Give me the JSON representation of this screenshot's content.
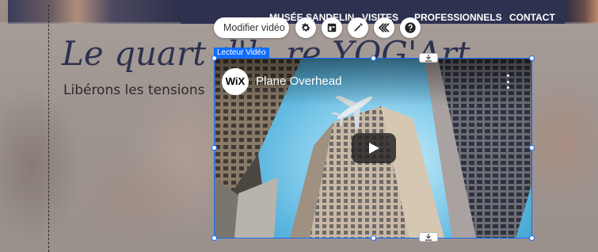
{
  "nav": {
    "items": [
      {
        "label": "MUSÉE SANDELIN"
      },
      {
        "label": "VISITES"
      },
      {
        "label": "PROFESSIONNELS"
      },
      {
        "label": "CONTACT"
      }
    ]
  },
  "hero": {
    "title": "Le quart d'h",
    "title_tail": "re YOG'Art",
    "subtitle": "Libérons les tensions"
  },
  "toolbar": {
    "edit_video_label": "Modifier vidéo",
    "icons": [
      "gear-icon",
      "layout-icon",
      "pen-icon",
      "animation-icon",
      "help-icon"
    ]
  },
  "selection": {
    "label": "Lecteur Vidéo",
    "color": "#116dff"
  },
  "video": {
    "logo_text": "WiX",
    "title": "Plane Overhead",
    "play_color": "#212121"
  },
  "colors": {
    "nav_bg": "#2e3250",
    "title_color": "#2d3150",
    "selection_blue": "#116dff"
  }
}
